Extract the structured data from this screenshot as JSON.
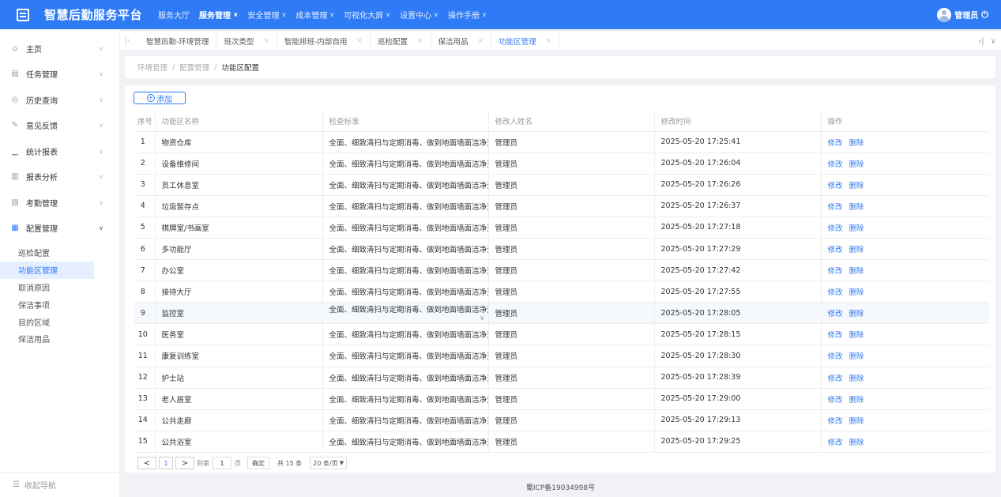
{
  "topbar": {
    "title": "智慧后勤服务平台",
    "nav": [
      {
        "label": "服务大厅",
        "chevron": false,
        "active": false
      },
      {
        "label": "服务管理",
        "chevron": true,
        "active": true
      },
      {
        "label": "安全管理",
        "chevron": true,
        "active": false
      },
      {
        "label": "成本管理",
        "chevron": true,
        "active": false
      },
      {
        "label": "可视化大屏",
        "chevron": true,
        "active": false
      },
      {
        "label": "设置中心",
        "chevron": true,
        "active": false
      },
      {
        "label": "操作手册",
        "chevron": true,
        "active": false
      }
    ],
    "user": "管理员"
  },
  "sidebar": {
    "items": [
      {
        "label": "主页",
        "icon": "home-icon",
        "glyph": "⌂"
      },
      {
        "label": "任务管理",
        "icon": "task-icon",
        "glyph": "▤"
      },
      {
        "label": "历史查询",
        "icon": "history-icon",
        "glyph": "◎"
      },
      {
        "label": "意见反馈",
        "icon": "feedback-icon",
        "glyph": "✎"
      },
      {
        "label": "统计报表",
        "icon": "stats-icon",
        "glyph": "▁"
      },
      {
        "label": "报表分析",
        "icon": "analysis-icon",
        "glyph": "▥"
      },
      {
        "label": "考勤管理",
        "icon": "attendance-icon",
        "glyph": "▧"
      },
      {
        "label": "配置管理",
        "icon": "config-icon",
        "glyph": "▦"
      }
    ],
    "sub_items": [
      "巡检配置",
      "功能区管理",
      "取消原因",
      "保洁事项",
      "目的区域",
      "保洁用品"
    ],
    "active_sub": 1,
    "collapse_label": "收起导航"
  },
  "tabs": [
    {
      "label": "智慧后勤-环境管理",
      "closable": false,
      "active": false
    },
    {
      "label": "班次类型",
      "closable": true,
      "active": false
    },
    {
      "label": "智能排班-内部自用",
      "closable": true,
      "active": false
    },
    {
      "label": "巡检配置",
      "closable": true,
      "active": false
    },
    {
      "label": "保洁用品",
      "closable": true,
      "active": false
    },
    {
      "label": "功能区管理",
      "closable": true,
      "active": true
    }
  ],
  "breadcrumb": [
    "环境管理",
    "配置管理",
    "功能区配置"
  ],
  "add_button": "添加",
  "table": {
    "headers": [
      "序号",
      "功能区名称",
      "检查标准",
      "修改人姓名",
      "修改时间",
      "操作"
    ],
    "standard_text": "全面、细致清扫与定期消毒、做到地面墙面洁净无",
    "rows": [
      {
        "no": "1",
        "name": "物资仓库",
        "editor": "管理员",
        "time": "2025-05-20 17:25:41"
      },
      {
        "no": "2",
        "name": "设备维修间",
        "editor": "管理员",
        "time": "2025-05-20 17:26:04"
      },
      {
        "no": "3",
        "name": "员工休息室",
        "editor": "管理员",
        "time": "2025-05-20 17:26:26"
      },
      {
        "no": "4",
        "name": "垃圾暂存点",
        "editor": "管理员",
        "time": "2025-05-20 17:26:37"
      },
      {
        "no": "5",
        "name": "棋牌室/书画室",
        "editor": "管理员",
        "time": "2025-05-20 17:27:18"
      },
      {
        "no": "6",
        "name": "多功能厅",
        "editor": "管理员",
        "time": "2025-05-20 17:27:29"
      },
      {
        "no": "7",
        "name": "办公室",
        "editor": "管理员",
        "time": "2025-05-20 17:27:42"
      },
      {
        "no": "8",
        "name": "接待大厅",
        "editor": "管理员",
        "time": "2025-05-20 17:27:55"
      },
      {
        "no": "9",
        "name": "监控室",
        "editor": "管理员",
        "time": "2025-05-20 17:28:05"
      },
      {
        "no": "10",
        "name": "医务室",
        "editor": "管理员",
        "time": "2025-05-20 17:28:15"
      },
      {
        "no": "11",
        "name": "康复训练室",
        "editor": "管理员",
        "time": "2025-05-20 17:28:30"
      },
      {
        "no": "12",
        "name": "护士站",
        "editor": "管理员",
        "time": "2025-05-20 17:28:39"
      },
      {
        "no": "13",
        "name": "老人居室",
        "editor": "管理员",
        "time": "2025-05-20 17:29:00"
      },
      {
        "no": "14",
        "name": "公共走廊",
        "editor": "管理员",
        "time": "2025-05-20 17:29:13"
      },
      {
        "no": "15",
        "name": "公共浴室",
        "editor": "管理员",
        "time": "2025-05-20 17:29:25"
      }
    ],
    "highlight_row": 9,
    "edit_label": "修改",
    "delete_label": "删除"
  },
  "pager": {
    "current": "1",
    "goto_prefix": "到第",
    "goto_value": "1",
    "goto_suffix": "页",
    "confirm": "确定",
    "total": "共 15 条",
    "page_size": "20 条/页"
  },
  "footer": "蜀ICP备19034998号"
}
